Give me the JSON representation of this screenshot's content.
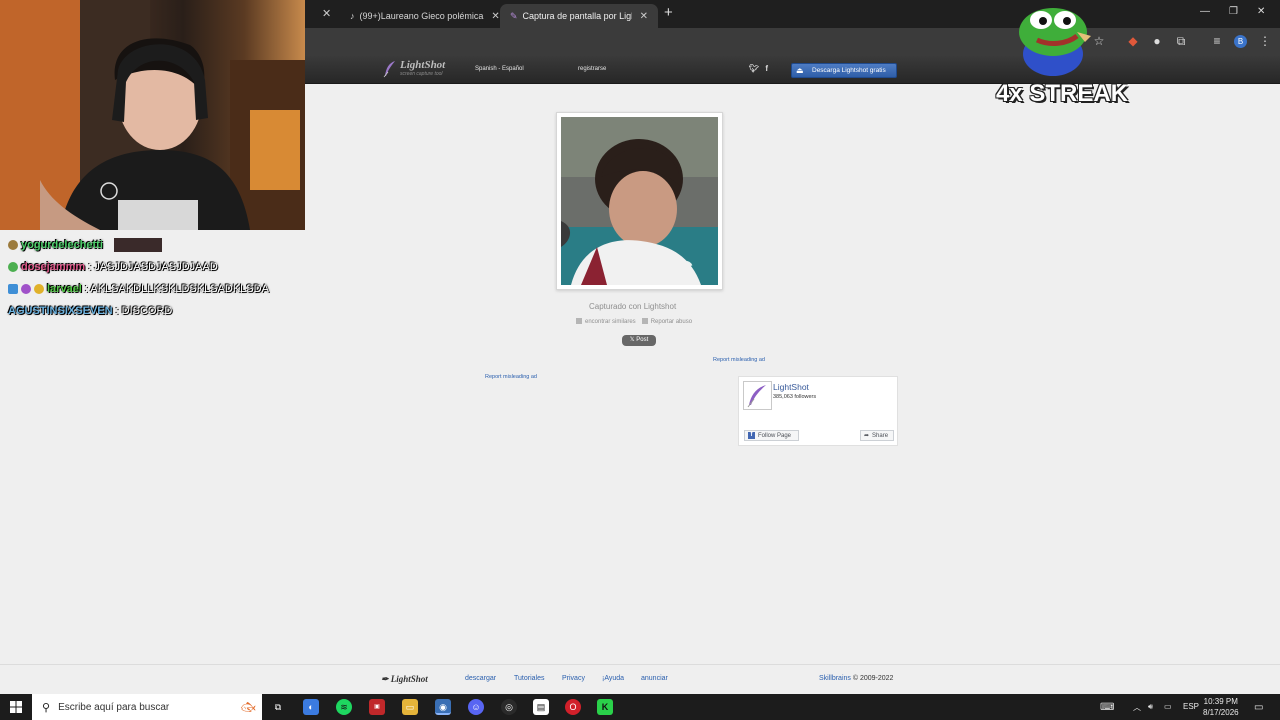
{
  "browser": {
    "tabs": [
      {
        "label": "(99+)Laureano Gieco polémica",
        "active": false
      },
      {
        "label": "Captura de pantalla por Lightsh",
        "active": true
      }
    ]
  },
  "lightshot_header": {
    "logo_name": "LightShot",
    "logo_tag": "screen capture tool",
    "language": "Spanish - Español",
    "register": "registrarse",
    "download_button": "Descarga Lightshot gratis"
  },
  "content": {
    "captured_label": "Capturado con Lightshot",
    "find_similar": "encontrar similares",
    "report_abuse": "Reportar abuso",
    "post_button": "Post",
    "report_ad_1": "Report misleading ad",
    "report_ad_2": "Report misleading ad",
    "fb": {
      "page_name": "LightShot",
      "followers": "385,063 followers",
      "follow_label": "Follow Page",
      "share_label": "Share"
    }
  },
  "footer": {
    "logo": "LightShot",
    "links": [
      "descargar",
      "Tutoriales",
      "Privacy",
      "¡Ayuda",
      "anunciar"
    ],
    "copyright_link": "Skillbrains",
    "copyright_rest": "© 2009-2022"
  },
  "stream_overlay": {
    "streak": "4x STREAK",
    "chat": [
      {
        "user": "yogurdelechetti",
        "message": "",
        "color": "#4fd06c"
      },
      {
        "user": "dosejammm",
        "message": ": JASJDJASDJASJDJAAD",
        "color": "#e05a8c"
      },
      {
        "user": "larvael",
        "message": ": AKLSAKDLLKSKLDSKLSADKLSDA",
        "color": "#56c94a"
      },
      {
        "user": "AGUSTINSIXSEVEN",
        "message": ": DISCORD",
        "color": "#6db3e0"
      }
    ]
  },
  "taskbar": {
    "search_placeholder": "Escribe aquí para buscar",
    "language": "ESP",
    "time": "10:39 PM",
    "date": "8/17/2026"
  }
}
